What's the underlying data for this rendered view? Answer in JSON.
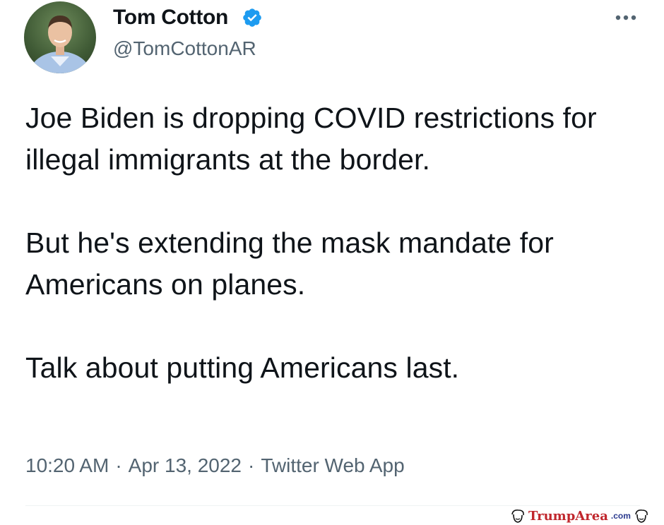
{
  "author": {
    "name": "Tom Cotton",
    "handle": "@TomCottonAR",
    "verified_icon": "verified-badge-icon",
    "verified_color": "#1d9bf0"
  },
  "tweet": {
    "paragraphs": [
      "Joe Biden is dropping COVID restrictions for illegal immigrants at the border.",
      "But he's extending the mask mandate for Americans on planes.",
      "Talk about putting Americans last."
    ],
    "time": "10:20 AM",
    "date": "Apr 13, 2022",
    "source": "Twitter Web App",
    "separator": "·"
  },
  "menu": {
    "icon": "more-options-icon"
  },
  "watermark": {
    "text": "TrumpArea",
    "suffix": ".com",
    "color": "#c0272d"
  }
}
